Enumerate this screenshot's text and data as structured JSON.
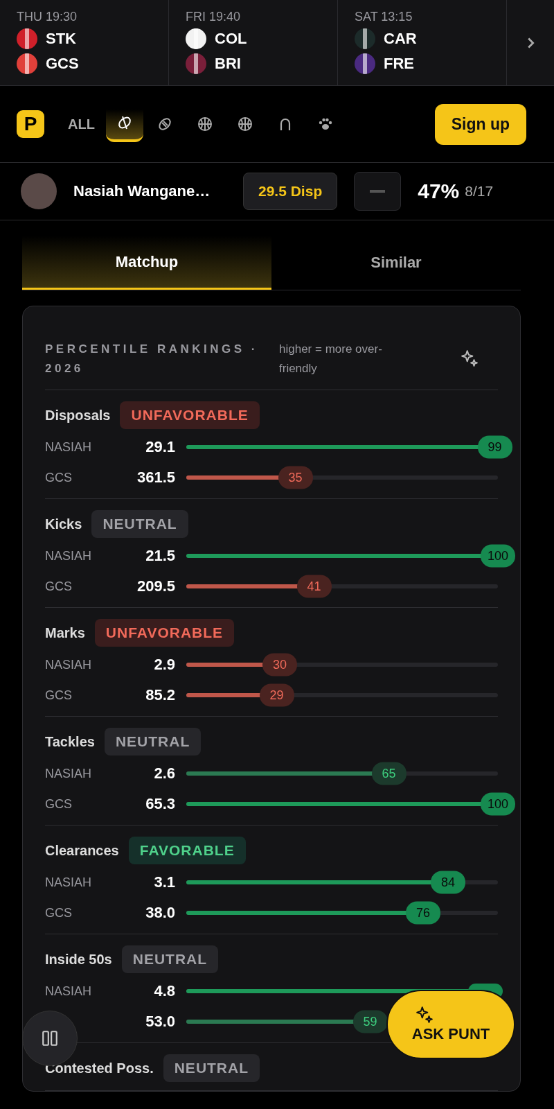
{
  "fixtures": [
    {
      "time": "THU 19:30",
      "teams": [
        {
          "code": "STK",
          "color": "#d0202a"
        },
        {
          "code": "GCS",
          "color": "#e0403a"
        }
      ]
    },
    {
      "time": "FRI 19:40",
      "teams": [
        {
          "code": "COL",
          "color": "#f2f2f2"
        },
        {
          "code": "BRI",
          "color": "#7a1f3a"
        }
      ]
    },
    {
      "time": "SAT 13:15",
      "teams": [
        {
          "code": "CAR",
          "color": "#1c2b2a"
        },
        {
          "code": "FRE",
          "color": "#4a2a80"
        }
      ]
    }
  ],
  "nav": {
    "logo": "P",
    "filters": [
      {
        "kind": "text",
        "label": "ALL",
        "selected": false
      },
      {
        "kind": "afl",
        "selected": true
      },
      {
        "kind": "rugby",
        "selected": false
      },
      {
        "kind": "basketball",
        "selected": false
      },
      {
        "kind": "basketball",
        "selected": false
      },
      {
        "kind": "horseshoe",
        "selected": false
      },
      {
        "kind": "paw",
        "selected": false
      }
    ],
    "signup": "Sign up"
  },
  "player": {
    "name": "Nasiah Wangane…",
    "line": "29.5 Disp",
    "percent": "47%",
    "record": "8/17"
  },
  "tabs": [
    {
      "label": "Matchup",
      "selected": true
    },
    {
      "label": "Similar",
      "selected": false
    }
  ],
  "card": {
    "title": "PERCENTILE RANKINGS · 2026",
    "note": "higher = more over-friendly",
    "stats": [
      {
        "name": "Disposals",
        "rating": {
          "kind": "unfavorable",
          "label": "UNFAVORABLE"
        },
        "rows": [
          {
            "label": "NASIAH",
            "value": "29.1",
            "level": 0.99,
            "rank": "99",
            "kind": "strong"
          },
          {
            "label": "GCS",
            "value": "361.5",
            "level": 0.35,
            "rank": "35",
            "kind": "weak"
          }
        ]
      },
      {
        "name": "Kicks",
        "rating": {
          "kind": "neutral",
          "label": "NEUTRAL"
        },
        "rows": [
          {
            "label": "NASIAH",
            "value": "21.5",
            "level": 1,
            "rank": "100",
            "kind": "strong"
          },
          {
            "label": "GCS",
            "value": "209.5",
            "level": 0.41,
            "rank": "41",
            "kind": "weak"
          }
        ]
      },
      {
        "name": "Marks",
        "rating": {
          "kind": "unfavorable",
          "label": "UNFAVORABLE"
        },
        "rows": [
          {
            "label": "NASIAH",
            "value": "2.9",
            "level": 0.3,
            "rank": "30",
            "kind": "weak"
          },
          {
            "label": "GCS",
            "value": "85.2",
            "level": 0.29,
            "rank": "29",
            "kind": "weak"
          }
        ]
      },
      {
        "name": "Tackles",
        "rating": {
          "kind": "neutral",
          "label": "NEUTRAL"
        },
        "rows": [
          {
            "label": "NASIAH",
            "value": "2.6",
            "level": 0.65,
            "rank": "65",
            "kind": "moderate"
          },
          {
            "label": "GCS",
            "value": "65.3",
            "level": 1,
            "rank": "100",
            "kind": "strong"
          }
        ]
      },
      {
        "name": "Clearances",
        "rating": {
          "kind": "favorable",
          "label": "FAVORABLE"
        },
        "rows": [
          {
            "label": "NASIAH",
            "value": "3.1",
            "level": 0.84,
            "rank": "84",
            "kind": "strong"
          },
          {
            "label": "GCS",
            "value": "38.0",
            "level": 0.76,
            "rank": "76",
            "kind": "strong"
          }
        ]
      },
      {
        "name": "Inside 50s",
        "rating": {
          "kind": "neutral",
          "label": "NEUTRAL"
        },
        "rows": [
          {
            "label": "NASIAH",
            "value": "4.8",
            "level": 0.96,
            "kind": "strong"
          },
          {
            "value": "53.0",
            "level": 0.59,
            "rank": "59",
            "kind": "moderate"
          }
        ]
      },
      {
        "name": "Contested Poss.",
        "rating": {
          "kind": "neutral",
          "label": "NEUTRAL"
        }
      }
    ]
  },
  "ask": "ASK PUNT"
}
